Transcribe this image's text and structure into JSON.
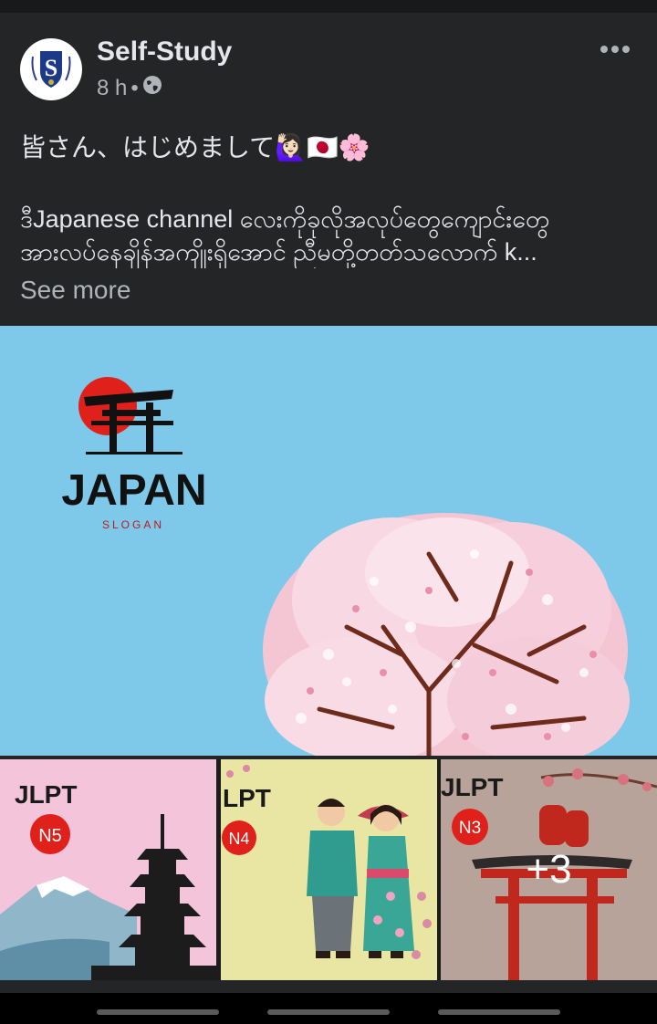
{
  "post": {
    "author": "Self-Study",
    "time": "8 h",
    "dot": "•",
    "greeting": "皆さん、はじめまして🙋🏻‍♀️🇯🇵🌸",
    "body_line1": "ဒီJapanese channel လေးကိုခုလိုအလုပ်တွေကျောင်းတွေ",
    "body_line2": "အားလပ်နေချိန်အကျိုးရှိအောင် ညီမတို့တတ်သလောက် k...",
    "see_more": "See more",
    "more_icon": "more-horizontal-icon"
  },
  "main_image": {
    "logo_word": "JAPAN",
    "logo_sub": "SLOGAN"
  },
  "thumbnails": [
    {
      "title": "JLPT",
      "level": "N5"
    },
    {
      "title": "LPT",
      "level": "N4"
    },
    {
      "title": "JLPT",
      "level": "N3",
      "overlay": "+3"
    }
  ],
  "colors": {
    "background": "#242526",
    "text": "#e4e6eb",
    "secondary_text": "#b0b3b8",
    "sky": "#7ec8e9",
    "badge_red": "#e0201a"
  }
}
